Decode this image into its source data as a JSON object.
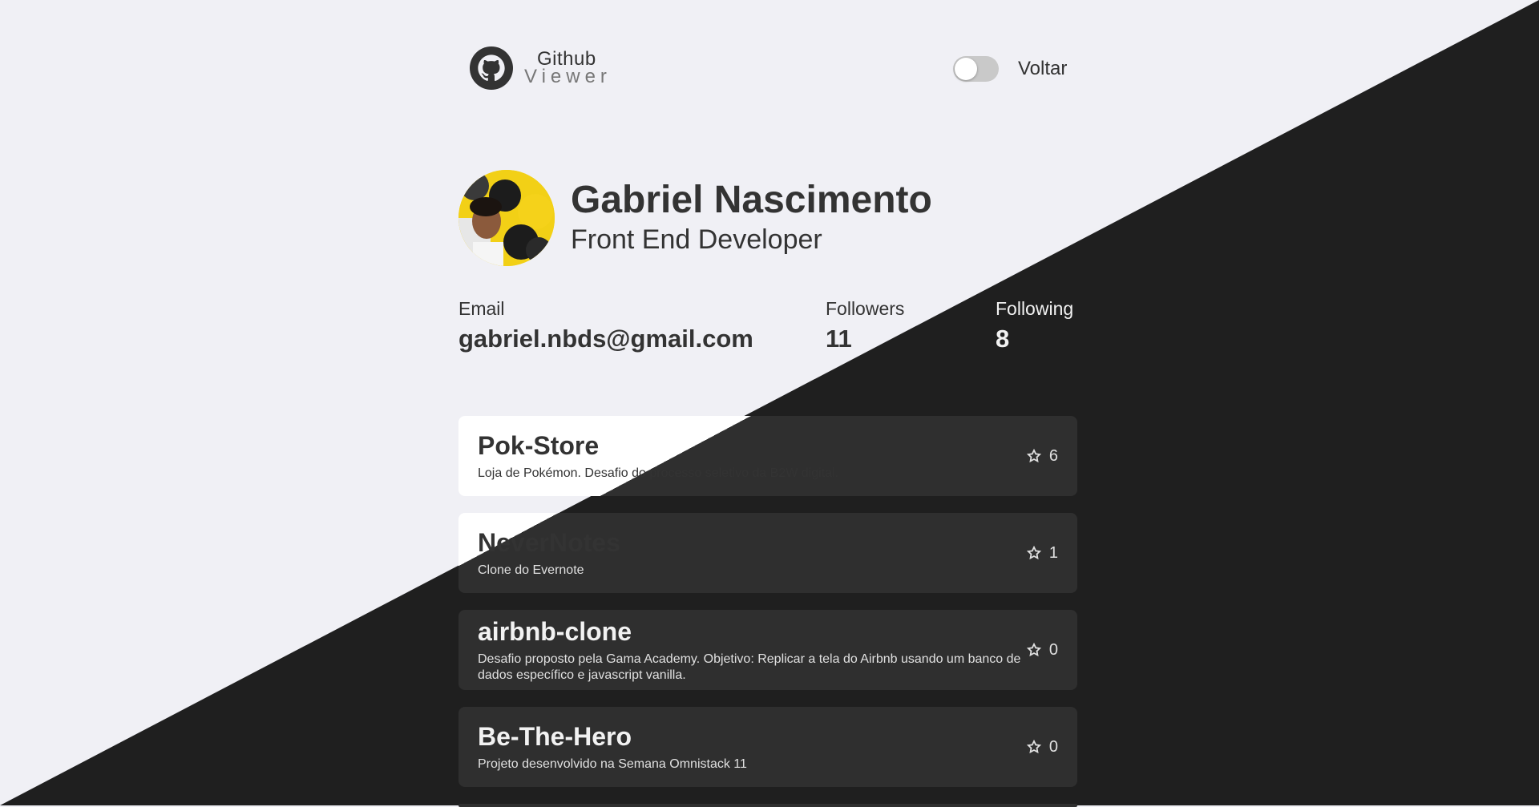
{
  "app": {
    "logo_title": "Github",
    "logo_subtitle": "Viewer"
  },
  "header": {
    "back_label": "Voltar",
    "theme_toggle_state": "off"
  },
  "profile": {
    "name": "Gabriel Nascimento",
    "role": "Front End Developer",
    "email_label": "Email",
    "email": "gabriel.nbds@gmail.com",
    "followers_label": "Followers",
    "followers": "11",
    "following_label": "Following",
    "following": "8"
  },
  "repos": [
    {
      "name": "Pok-Store",
      "description": "Loja de Pokémon. Desafio do processo seletivo da B2W digital.",
      "stars": "6"
    },
    {
      "name": "NeverNotes",
      "description": "Clone do Evernote",
      "stars": "1"
    },
    {
      "name": "airbnb-clone",
      "description": "Desafio proposto pela Gama Academy. Objetivo: Replicar a tela do Airbnb usando um banco de dados específico e javascript vanilla.",
      "stars": "0"
    },
    {
      "name": "Be-The-Hero",
      "description": "Projeto desenvolvido na Semana Omnistack 11",
      "stars": "0"
    }
  ],
  "colors": {
    "light_bg": "#f0f0f5",
    "dark_bg": "#1f1f1f",
    "card_dark": "#2f2f2f",
    "text_dark": "#333333"
  }
}
